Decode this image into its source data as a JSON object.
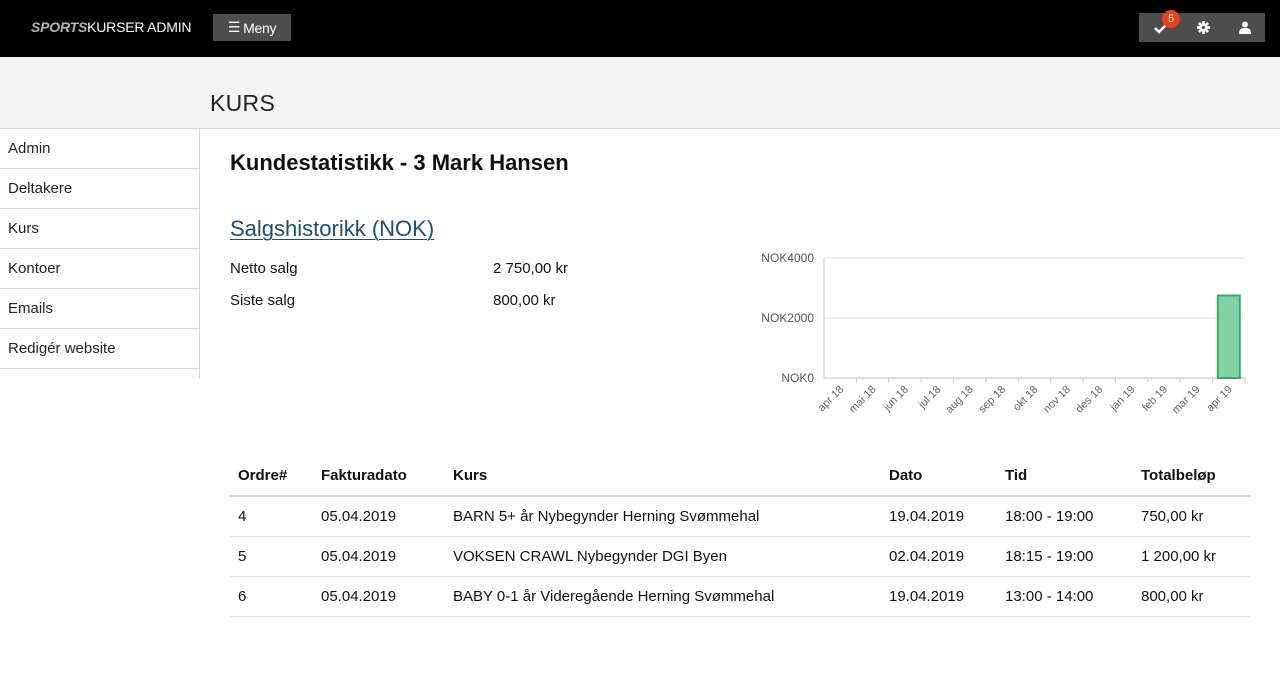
{
  "navbar": {
    "brand_prefix": "SPORTS",
    "brand_suffix": "KURSER ADMIN",
    "menu_label": "Meny",
    "menu_icon": "hamburger-icon",
    "tasks_icon": "check-icon",
    "tasks_badge": "5",
    "settings_icon": "gear-icon",
    "user_icon": "user-icon",
    "badge_color": "#e8411c"
  },
  "page": {
    "title": "KURS"
  },
  "sidebar": {
    "items": [
      {
        "label": "Admin"
      },
      {
        "label": "Deltakere"
      },
      {
        "label": "Kurs"
      },
      {
        "label": "Kontoer"
      },
      {
        "label": "Emails"
      },
      {
        "label": "Redigér website"
      }
    ]
  },
  "main": {
    "heading": "Kundestatistikk - 3 Mark Hansen",
    "sales_heading": "Salgshistorikk (NOK)",
    "stats": [
      {
        "label": "Netto salg",
        "value": "2 750,00 kr"
      },
      {
        "label": "Siste salg",
        "value": "800,00 kr"
      }
    ]
  },
  "chart_data": {
    "type": "bar",
    "categories": [
      "apr 18",
      "mai 18",
      "jun 18",
      "jul 18",
      "aug 18",
      "sep 18",
      "okt 18",
      "nov 18",
      "des 18",
      "jan 19",
      "feb 19",
      "mar 19",
      "apr 19"
    ],
    "values": [
      0,
      0,
      0,
      0,
      0,
      0,
      0,
      0,
      0,
      0,
      0,
      0,
      2750
    ],
    "ylim": [
      0,
      4000
    ],
    "yticks": [
      "NOK0",
      "NOK2000",
      "NOK4000"
    ],
    "ytick_values": [
      0,
      2000,
      4000
    ],
    "bar_color": "#7fd3a3",
    "bar_border": "#3aa86a",
    "grid": true
  },
  "orders": {
    "headers": [
      "Ordre#",
      "Fakturadato",
      "Kurs",
      "Dato",
      "Tid",
      "Totalbeløp"
    ],
    "rows": [
      [
        "4",
        "05.04.2019",
        "BARN 5+ år Nybegynder Herning Svømmehal",
        "19.04.2019",
        "18:00 - 19:00",
        "750,00 kr"
      ],
      [
        "5",
        "05.04.2019",
        "VOKSEN CRAWL Nybegynder DGI Byen",
        "02.04.2019",
        "18:15 - 19:00",
        "1 200,00 kr"
      ],
      [
        "6",
        "05.04.2019",
        "BABY 0-1 år Videregående Herning Svømmehal",
        "19.04.2019",
        "13:00 - 14:00",
        "800,00 kr"
      ]
    ]
  }
}
